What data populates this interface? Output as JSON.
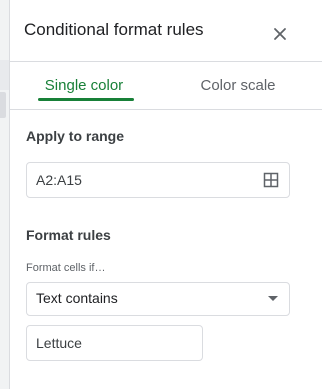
{
  "panel": {
    "title": "Conditional format rules"
  },
  "icons": {
    "close": "close-icon",
    "range_select": "grid-select-icon",
    "dropdown": "dropdown-arrow-icon"
  },
  "tabs": [
    {
      "label": "Single color",
      "active": true
    },
    {
      "label": "Color scale",
      "active": false
    }
  ],
  "apply_to_range": {
    "label": "Apply to range",
    "value": "A2:A15"
  },
  "format_rules": {
    "label": "Format rules",
    "condition_label": "Format cells if…",
    "condition_value": "Text contains",
    "text_value": "Lettuce"
  },
  "colors": {
    "accent": "#188038",
    "border": "#dadce0",
    "text": "#202124",
    "muted": "#5f6368"
  }
}
